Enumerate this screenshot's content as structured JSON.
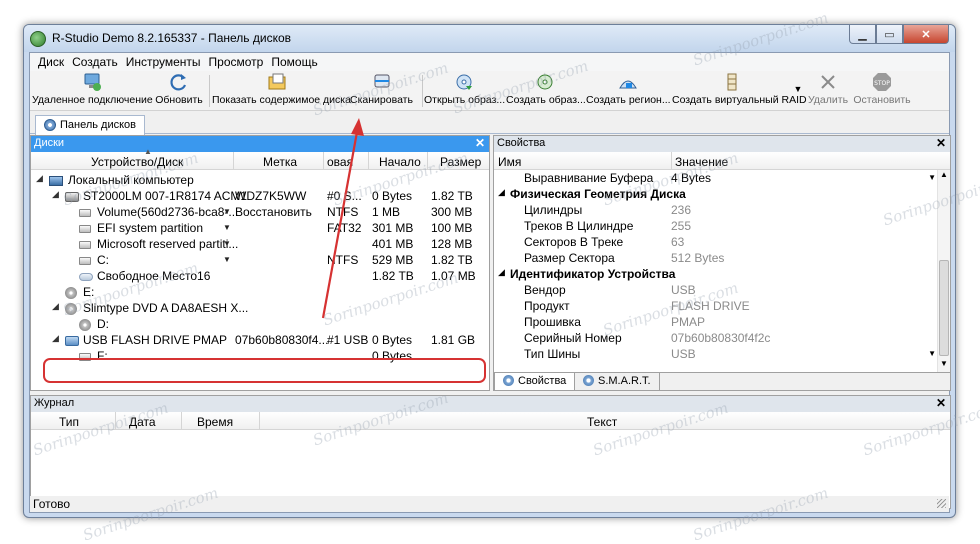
{
  "window": {
    "title": "R-Studio Demo 8.2.165337 - Панель дисков"
  },
  "menu": [
    "Диск",
    "Создать",
    "Инструменты",
    "Просмотр",
    "Помощь"
  ],
  "toolbar": [
    {
      "label": "Удаленное подключение",
      "icon": "remote-connect-icon",
      "enabled": true
    },
    {
      "label": "Обновить",
      "icon": "refresh-icon",
      "enabled": true
    },
    {
      "label": "Показать содержимое диска",
      "icon": "show-contents-icon",
      "enabled": true
    },
    {
      "label": "Сканировать",
      "icon": "scan-icon",
      "enabled": true
    },
    {
      "label": "Открыть образ...",
      "icon": "open-image-icon",
      "enabled": true
    },
    {
      "label": "Создать образ...",
      "icon": "create-image-icon",
      "enabled": true
    },
    {
      "label": "Создать регион...",
      "icon": "create-region-icon",
      "enabled": true
    },
    {
      "label": "Создать виртуальный RAID",
      "icon": "virtual-raid-icon",
      "enabled": true
    },
    {
      "label": "Удалить",
      "icon": "delete-icon",
      "enabled": false
    },
    {
      "label": "Остановить",
      "icon": "stop-icon",
      "enabled": false
    }
  ],
  "doc_tab": "Панель дисков",
  "disks_pane": {
    "title": "Диски",
    "columns": [
      "Устройство/Диск",
      "Метка",
      "овая",
      "Начало",
      "Размер"
    ],
    "rows": [
      {
        "device": "Локальный компьютер",
        "label": "",
        "fs": "",
        "start": "",
        "size": ""
      },
      {
        "device": "ST2000LM 007-1R8174 ACM1",
        "label": "WDZ7K5WW",
        "fs": "#0 S...",
        "start": "0 Bytes",
        "size": "1.82 TB"
      },
      {
        "device": "Volume(560d2736-bca8-...",
        "label": "Восстановить",
        "fs": "NTFS",
        "start": "1 MB",
        "size": "300 MB"
      },
      {
        "device": "EFI system partition",
        "label": "",
        "fs": "FAT32",
        "start": "301 MB",
        "size": "100 MB"
      },
      {
        "device": "Microsoft reserved partiti...",
        "label": "",
        "fs": "",
        "start": "401 MB",
        "size": "128 MB"
      },
      {
        "device": "C:",
        "label": "",
        "fs": "NTFS",
        "start": "529 MB",
        "size": "1.82 TB"
      },
      {
        "device": "Свободное Место16",
        "label": "",
        "fs": "",
        "start": "1.82 TB",
        "size": "1.07 MB"
      },
      {
        "device": "E:",
        "label": "",
        "fs": "",
        "start": "",
        "size": ""
      },
      {
        "device": "Slimtype DVD A DA8AESH X...",
        "label": "",
        "fs": "",
        "start": "",
        "size": ""
      },
      {
        "device": "D:",
        "label": "",
        "fs": "",
        "start": "",
        "size": ""
      },
      {
        "device": "USB FLASH DRIVE PMAP",
        "label": "07b60b80830f4...",
        "fs": "#1 USB",
        "start": "0 Bytes",
        "size": "1.81 GB"
      },
      {
        "device": "F:",
        "label": "",
        "fs": "",
        "start": "0 Bytes",
        "size": ""
      }
    ]
  },
  "props_pane": {
    "title": "Свойства",
    "columns": [
      "Имя",
      "Значение"
    ],
    "rows": [
      {
        "name": "Выравнивание Буфера",
        "value": "4 Bytes",
        "group": false
      },
      {
        "name": "Физическая Геометрия Диска",
        "value": "",
        "group": true
      },
      {
        "name": "Цилиндры",
        "value": "236",
        "group": false
      },
      {
        "name": "Треков В Цилиндре",
        "value": "255",
        "group": false
      },
      {
        "name": "Секторов В Треке",
        "value": "63",
        "group": false
      },
      {
        "name": "Размер Сектора",
        "value": "512 Bytes",
        "group": false
      },
      {
        "name": "Идентификатор Устройства",
        "value": "",
        "group": true
      },
      {
        "name": "Вендор",
        "value": "USB",
        "group": false
      },
      {
        "name": "Продукт",
        "value": "FLASH DRIVE",
        "group": false
      },
      {
        "name": "Прошивка",
        "value": "PMAP",
        "group": false
      },
      {
        "name": "Серийный Номер",
        "value": "07b60b80830f4f2c",
        "group": false
      },
      {
        "name": "Тип Шины",
        "value": "USB",
        "group": false
      }
    ],
    "tabs": [
      "Свойства",
      "S.M.A.R.T."
    ]
  },
  "log_pane": {
    "title": "Журнал",
    "columns": [
      "Тип",
      "Дата",
      "Время",
      "Текст"
    ]
  },
  "status": "Готово",
  "watermark": "Sorinpoorpoir.com",
  "colors": {
    "accent": "#3a98ee",
    "highlight": "#d63232"
  }
}
